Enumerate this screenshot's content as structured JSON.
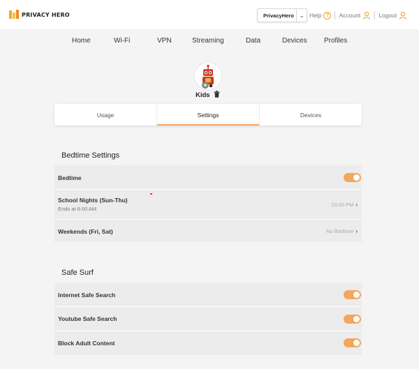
{
  "brand": {
    "name": "PRIVACY HERO"
  },
  "header": {
    "account_select": "PrivacyHero",
    "help": "Help",
    "account": "Account",
    "logout": "Logout"
  },
  "nav": [
    "Home",
    "Wi-Fi",
    "VPN",
    "Streaming",
    "Data",
    "Devices",
    "Profiles"
  ],
  "profile": {
    "name": "Kids"
  },
  "tabs": [
    {
      "label": "Usage",
      "active": false
    },
    {
      "label": "Settings",
      "active": true
    },
    {
      "label": "Devices",
      "active": false
    }
  ],
  "bedtime": {
    "title": "Bedtime Settings",
    "bedtime_label": "Bedtime",
    "bedtime_on": true,
    "school_nights_label": "School Nights (Sun-Thu)",
    "school_nights_sub": "Ends at 6:00 AM",
    "school_nights_value": "10:00 PM",
    "weekends_label": "Weekends (Fri, Sat)",
    "weekends_value": "No Bedtime"
  },
  "safe_surf": {
    "title": "Safe Surf",
    "items": [
      {
        "label": "Internet Safe Search",
        "on": true
      },
      {
        "label": "Youtube Safe Search",
        "on": true
      },
      {
        "label": "Block Adult Content",
        "on": true
      }
    ]
  },
  "colors": {
    "accent": "#f4a65d",
    "help": "#f0a030"
  }
}
